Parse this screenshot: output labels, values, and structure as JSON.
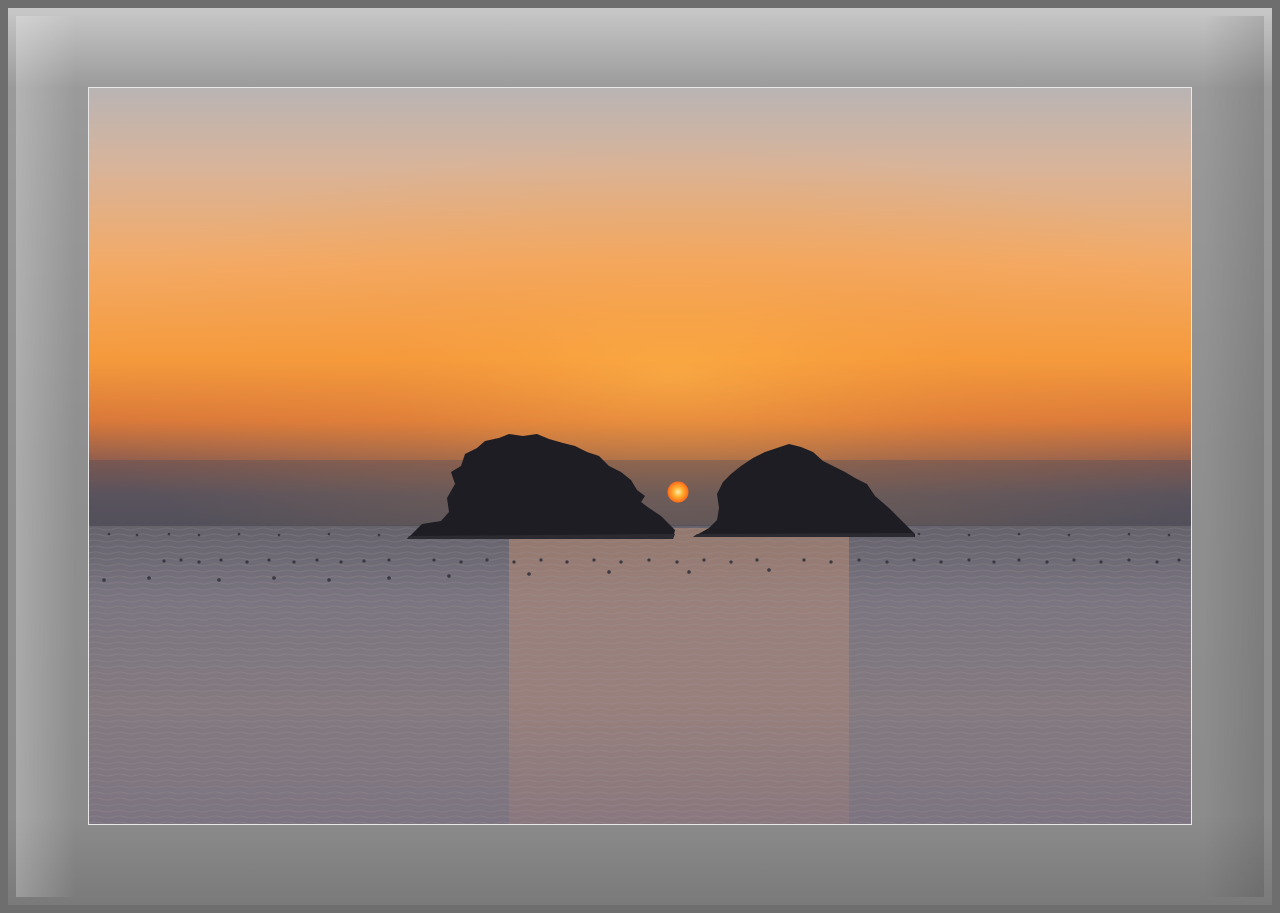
{
  "scene": {
    "subject": "sunset-over-sea-with-two-islets",
    "colors": {
      "sky_top": "#b9b2b0",
      "sky_glow": "#f7a24a",
      "sky_horizon": "#5e5a63",
      "sun": "#ff7a1e",
      "island": "#1c1c22",
      "sea": "#7c7680",
      "mat": "#9a9a9a"
    }
  }
}
